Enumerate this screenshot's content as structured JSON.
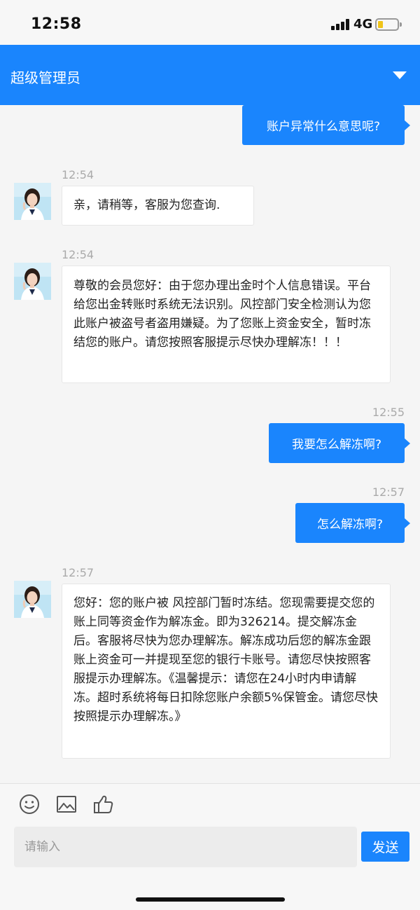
{
  "status_bar": {
    "time": "12:58",
    "network": "4G",
    "battery_level": 0.25
  },
  "header": {
    "title": "超级管理员",
    "icon": "chevron-down-icon"
  },
  "messages": [
    {
      "from": "user",
      "text": "账户异常什么意思呢?"
    },
    {
      "from": "agent",
      "time": "12:54",
      "text": "亲，请稍等，客服为您查询."
    },
    {
      "from": "agent",
      "time": "12:54",
      "text": "尊敬的会员您好：由于您办理出金时个人信息错误。平台给您出金转账时系统无法识别。风控部门安全检测认为您此账户被盗号者盗用嫌疑。为了您账上资金安全，暂时冻结您的账户。请您按照客服提示尽快办理解冻！！！"
    },
    {
      "from": "user",
      "time": "12:55",
      "text": "我要怎么解冻啊?"
    },
    {
      "from": "user",
      "time": "12:57",
      "text": "怎么解冻啊?"
    },
    {
      "from": "agent",
      "time": "12:57",
      "text": "您好：您的账户被 风控部门暂时冻结。您现需要提交您的账上同等资金作为解冻金。即为326214。提交解冻金后。客服将尽快为您办理解冻。解冻成功后您的解冻金跟账上资金可一并提现至您的银行卡账号。请您尽快按照客服提示办理解冻。《温馨提示：请您在24小时内申请解冻。超时系统将每日扣除您账户余额5%保管金。请您尽快按照提示办理解冻。》"
    }
  ],
  "toolbar": {
    "icons": [
      "emoji-icon",
      "image-icon",
      "thumbs-up-icon"
    ]
  },
  "input": {
    "placeholder": "请输入",
    "value": ""
  },
  "send_button": {
    "label": "发送"
  },
  "colors": {
    "accent": "#1a85fd",
    "background": "#f5f5f5",
    "bubble_in": "#ffffff"
  }
}
